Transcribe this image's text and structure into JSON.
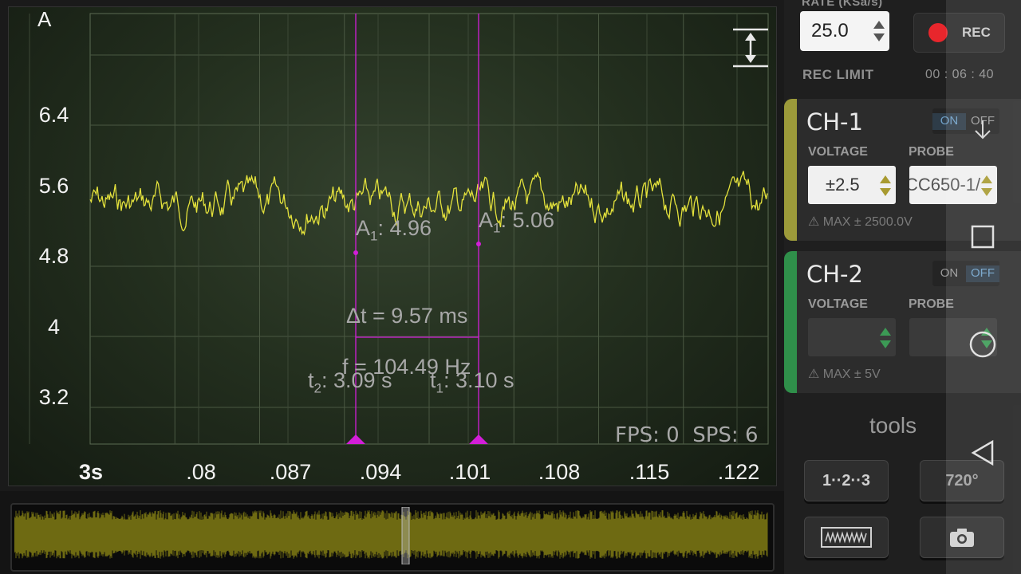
{
  "scope": {
    "channel_label": "A",
    "y_ticks": [
      "6.4",
      "5.6",
      "4.8",
      "4",
      "3.2"
    ],
    "x_ticks": [
      "3s",
      ".08",
      ".087",
      ".094",
      ".101",
      ".108",
      ".115",
      ".122"
    ],
    "cursor2": {
      "amp_prefix": "A",
      "amp_sub": "1",
      "amp_value": ": 4.96",
      "time_prefix": "t",
      "time_sub": "2",
      "time_value": ": 3.09 s"
    },
    "cursor1": {
      "amp_prefix": "A",
      "amp_sub": "1",
      "amp_value": ": 5.06",
      "time_prefix": "t",
      "time_sub": "1",
      "time_value": ": 3.10 s"
    },
    "delta_t": "Δt = 9.57 ms",
    "frequency": "f = 104.49 Hz",
    "fps": "FPS: 0",
    "sps": "SPS: 6",
    "trace_color": "#e4e23c",
    "cursor_color": "#d21ed8"
  },
  "panel": {
    "rate_label": "RATE (KSa/s)",
    "rate_value": "25.0",
    "rec_label": "REC",
    "rec_limit_label": "REC LIMIT",
    "rec_limit_time": "00 : 06 : 40",
    "channels": [
      {
        "name": "CH-1",
        "on": "ON",
        "off": "OFF",
        "voltage_label": "VOLTAGE",
        "voltage_value": "±2.5",
        "probe_label": "PROBE",
        "probe_value": "CC650-1/",
        "max": "⚠ MAX ± 2500.0V",
        "color": "#9c9a3a",
        "state": "on"
      },
      {
        "name": "CH-2",
        "on": "ON",
        "off": "OFF",
        "voltage_label": "VOLTAGE",
        "voltage_value": "",
        "probe_label": "PROBE",
        "probe_value": "",
        "max": "⚠ MAX ± 5V",
        "color": "#2f8f4a",
        "state": "off"
      }
    ],
    "tools_label": "tools",
    "tool_buttons": [
      "1··2··3",
      "720°"
    ]
  },
  "icons": [
    "vertical-scale-icon",
    "wave-icon",
    "camera-icon",
    "download-icon",
    "square-icon",
    "circle-icon",
    "back-triangle-icon"
  ]
}
